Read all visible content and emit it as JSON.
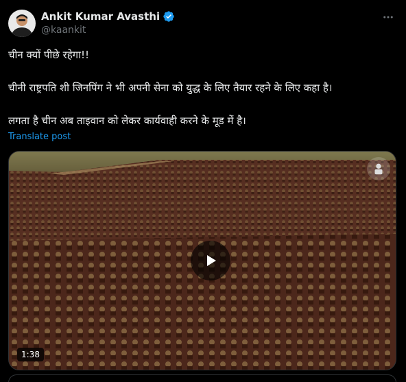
{
  "author": {
    "display_name": "Ankit Kumar Avasthi",
    "handle": "@kaankit",
    "verified": true,
    "avatar_icon": "avatar-photo"
  },
  "post": {
    "line1": "चीन क्यों पीछे रहेगा!!",
    "line2": "चीनी राष्ट्रपति शी जिनपिंग ने भी अपनी सेना को युद्ध के लिए तैयार रहने के लिए कहा है।",
    "line3": "लगता है चीन अब ताइवान को लेकर कार्यवाही करने के मूड में है।",
    "translate_label": "Translate post"
  },
  "media": {
    "duration": "1:38",
    "play_icon": "play-icon"
  },
  "icons": {
    "more": "more-options-icon",
    "verified": "verified-badge-icon"
  },
  "colors": {
    "background": "#000000",
    "text": "#e7e9ea",
    "secondary": "#71767b",
    "accent": "#1d9bf0",
    "border": "#2f3336"
  }
}
